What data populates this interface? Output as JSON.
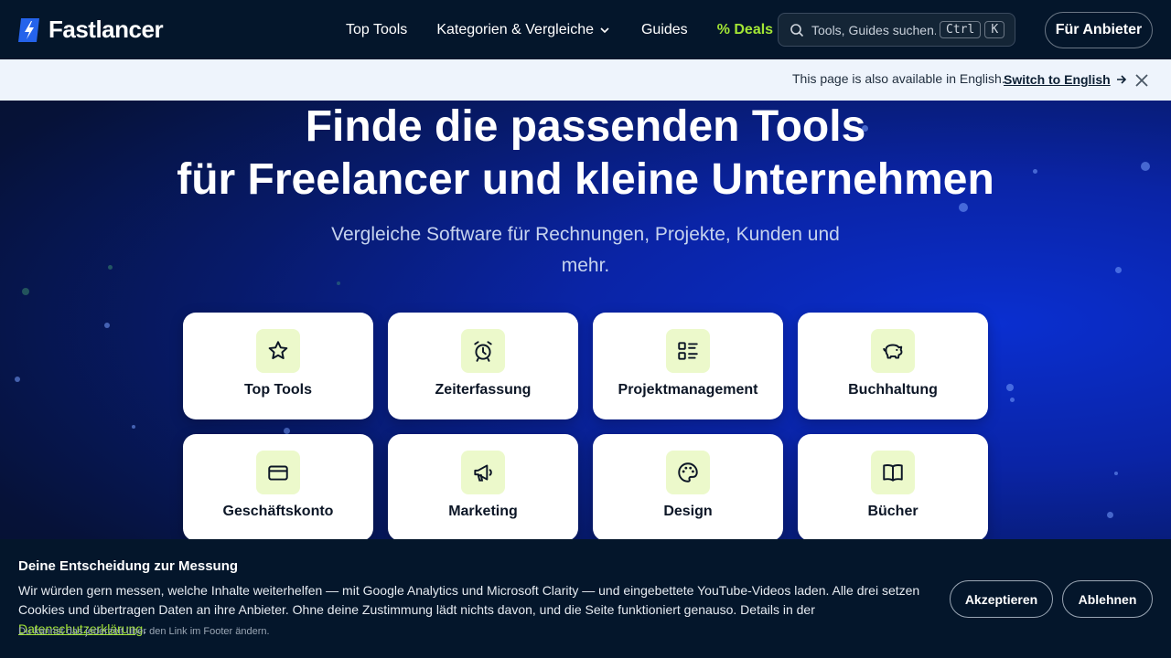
{
  "header": {
    "logo_text": "Fastlancer",
    "nav": [
      {
        "label": "Top Tools"
      },
      {
        "label": "Kategorien & Vergleiche",
        "has_dropdown": true
      },
      {
        "label": "Guides"
      },
      {
        "label": "% Deals"
      }
    ],
    "search": {
      "placeholder": "Tools, Guides suchen...",
      "shortcut_ctrl": "Ctrl",
      "shortcut_key": "K"
    },
    "cta_label": "Für Anbieter"
  },
  "lang_bar": {
    "text": "This page is also available in English.",
    "link_label": "Switch to English"
  },
  "hero": {
    "title_line1": "Finde die passenden Tools",
    "title_line2": "für Freelancer und kleine Unternehmen",
    "subtitle": "Vergleiche Software für Rechnungen, Projekte, Kunden und mehr."
  },
  "categories": [
    {
      "label": "Top Tools",
      "icon": "star-icon"
    },
    {
      "label": "Zeiterfassung",
      "icon": "alarm-clock-icon"
    },
    {
      "label": "Projektmanagement",
      "icon": "list-icon"
    },
    {
      "label": "Buchhaltung",
      "icon": "piggy-bank-icon"
    },
    {
      "label": "Geschäftskonto",
      "icon": "credit-card-icon"
    },
    {
      "label": "Marketing",
      "icon": "megaphone-icon"
    },
    {
      "label": "Design",
      "icon": "palette-icon"
    },
    {
      "label": "Bücher",
      "icon": "book-icon"
    }
  ],
  "cookie": {
    "title": "Deine Entscheidung zur Messung",
    "text": "Wir würden gern messen, welche Inhalte weiterhelfen — mit Google Analytics und Microsoft Clarity — und eingebettete YouTube-Videos laden. Alle drei setzen Cookies und übertragen Daten an ihre Anbieter. Ohne deine Zustimmung lädt nichts davon, und die Seite funktioniert genauso. Details in der",
    "link_label": "Datenschutzerklärung",
    "text_end": ".",
    "note": "Du kannst das jederzeit über den Link im Footer ändern.",
    "accept_label": "Akzeptieren",
    "reject_label": "Ablehnen"
  },
  "colors": {
    "accent_green": "#a3e635",
    "header_bg": "#04162b",
    "hero_blue": "#0a2fd0",
    "icon_tile_bg": "#ecf9cb"
  }
}
